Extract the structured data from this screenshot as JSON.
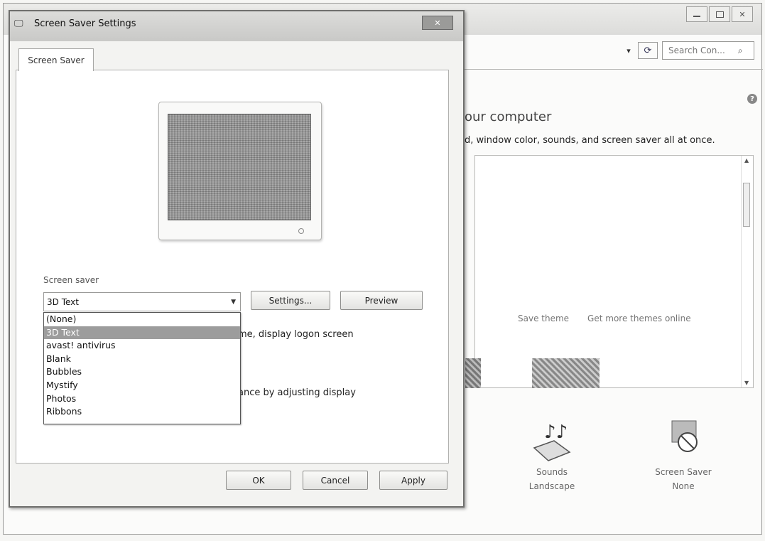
{
  "background_window": {
    "search_placeholder": "Search Con...",
    "heading": "our computer",
    "subtitle": "d, window color, sounds, and screen saver all at once.",
    "save_theme": "Save theme",
    "get_more_themes": "Get more themes online",
    "sounds": {
      "label": "Sounds",
      "value": "Landscape"
    },
    "screen_saver": {
      "label": "Screen Saver",
      "value": "None"
    }
  },
  "dialog": {
    "title": "Screen Saver Settings",
    "tab": "Screen Saver",
    "screen_saver_label": "Screen saver",
    "selected": "3D Text",
    "settings_button": "Settings...",
    "preview_button": "Preview",
    "options": [
      "(None)",
      "3D Text",
      "avast! antivirus",
      "Blank",
      "Bubbles",
      "Mystify",
      "Photos",
      "Ribbons"
    ],
    "selected_index": 1,
    "logon_partial": "me, display logon screen",
    "power_partial": "ance by adjusting display",
    "ok_button": "OK",
    "cancel_button": "Cancel",
    "apply_button": "Apply"
  }
}
